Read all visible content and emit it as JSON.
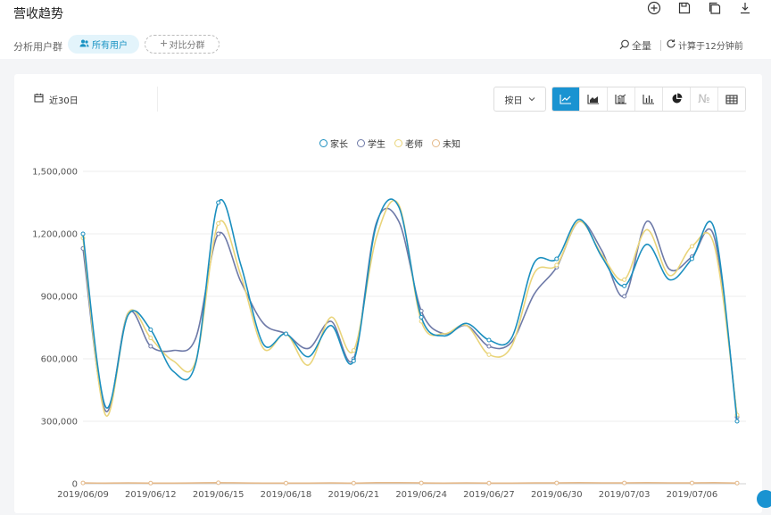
{
  "header": {
    "title": "营收趋势",
    "actions": [
      {
        "name": "add-icon"
      },
      {
        "name": "save-icon"
      },
      {
        "name": "copy-icon"
      },
      {
        "name": "download-icon"
      }
    ]
  },
  "filter_bar": {
    "group_label": "分析用户群",
    "all_users_chip": "所有用户",
    "compare_chip": "对比分群",
    "fullscreen_label": "全量",
    "calc_label": "计算于12分钟前"
  },
  "toolbar": {
    "date_range": "近30日",
    "granularity": "按日",
    "chart_types": [
      {
        "name": "line-chart-icon",
        "active": true
      },
      {
        "name": "area-chart-icon",
        "active": false
      },
      {
        "name": "combo-chart-icon",
        "active": false
      },
      {
        "name": "bar-chart-icon",
        "active": false
      },
      {
        "name": "pie-chart-icon",
        "active": false
      },
      {
        "name": "number-icon",
        "active": false,
        "glyph": "№"
      },
      {
        "name": "table-icon",
        "active": false
      }
    ]
  },
  "colors": {
    "accent": "#1a93d1",
    "series": [
      "#1b8fbf",
      "#6e7aa8",
      "#e9d47a",
      "#e4b98a"
    ]
  },
  "chart_data": {
    "type": "line",
    "x": [
      "2019/06/09",
      "2019/06/10",
      "2019/06/11",
      "2019/06/12",
      "2019/06/13",
      "2019/06/14",
      "2019/06/15",
      "2019/06/16",
      "2019/06/17",
      "2019/06/18",
      "2019/06/19",
      "2019/06/20",
      "2019/06/21",
      "2019/06/22",
      "2019/06/23",
      "2019/06/24",
      "2019/06/25",
      "2019/06/26",
      "2019/06/27",
      "2019/06/28",
      "2019/06/29",
      "2019/06/30",
      "2019/07/01",
      "2019/07/02",
      "2019/07/03",
      "2019/07/04",
      "2019/07/05",
      "2019/07/06",
      "2019/07/07",
      "2019/07/08"
    ],
    "x_tick_labels": [
      "2019/06/09",
      "2019/06/12",
      "2019/06/15",
      "2019/06/18",
      "2019/06/21",
      "2019/06/24",
      "2019/06/27",
      "2019/06/30",
      "2019/07/03",
      "2019/07/06"
    ],
    "y_tick_labels": [
      "0",
      "300,000",
      "600,000",
      "900,000",
      "1,200,000",
      "1,500,000"
    ],
    "ylim": [
      0,
      1500000
    ],
    "legend_position": "top-center",
    "series": [
      {
        "name": "家长",
        "color": "#1b8fbf",
        "values": [
          1200000,
          370000,
          810000,
          740000,
          540000,
          580000,
          1350000,
          1050000,
          670000,
          720000,
          610000,
          760000,
          590000,
          1240000,
          1330000,
          800000,
          710000,
          770000,
          690000,
          700000,
          1060000,
          1080000,
          1270000,
          1090000,
          950000,
          1150000,
          980000,
          1080000,
          1220000,
          300000
        ]
      },
      {
        "name": "学生",
        "color": "#6e7aa8",
        "values": [
          1130000,
          350000,
          820000,
          660000,
          640000,
          700000,
          1200000,
          970000,
          770000,
          720000,
          650000,
          780000,
          600000,
          1250000,
          1260000,
          830000,
          720000,
          760000,
          660000,
          680000,
          910000,
          1040000,
          1260000,
          1120000,
          900000,
          1260000,
          1030000,
          1090000,
          1180000,
          320000
        ]
      },
      {
        "name": "老师",
        "color": "#e9d47a",
        "values": [
          1180000,
          330000,
          820000,
          700000,
          590000,
          590000,
          1250000,
          1000000,
          650000,
          720000,
          570000,
          800000,
          640000,
          1180000,
          1340000,
          780000,
          720000,
          760000,
          620000,
          660000,
          1010000,
          1050000,
          1260000,
          1100000,
          980000,
          1220000,
          1000000,
          1140000,
          1140000,
          330000
        ]
      },
      {
        "name": "未知",
        "color": "#e4b98a",
        "values": [
          4000,
          3000,
          4000,
          3000,
          3000,
          4000,
          5000,
          4000,
          3000,
          3000,
          3000,
          4000,
          3000,
          5000,
          5000,
          4000,
          3000,
          4000,
          3000,
          3000,
          4000,
          4000,
          5000,
          4000,
          4000,
          5000,
          4000,
          4000,
          5000,
          3000
        ]
      }
    ]
  }
}
